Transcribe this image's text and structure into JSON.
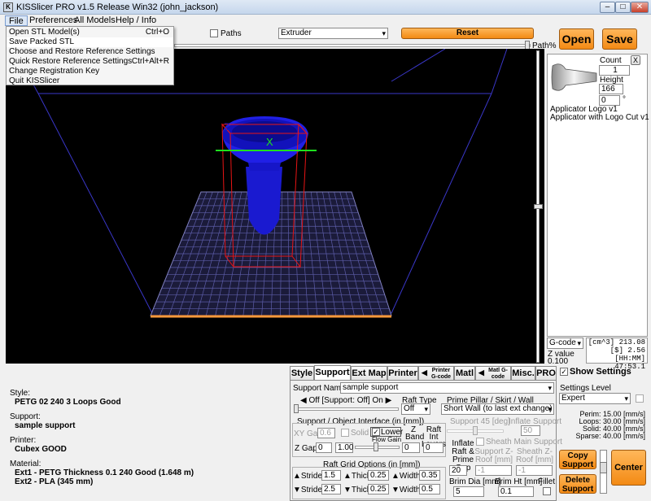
{
  "window": {
    "title": "KISSlicer PRO v1.5 Release Win32 (john_jackson)",
    "min": "–",
    "max": "□",
    "close": "✕"
  },
  "menu": [
    "File",
    "Preferences",
    "All Models",
    "Help / Info"
  ],
  "file_menu": [
    {
      "label": "Open STL Model(s)",
      "shortcut": "Ctrl+O"
    },
    {
      "label": "Save Packed STL",
      "shortcut": ""
    },
    {
      "label": "Choose and Restore Reference Settings",
      "shortcut": ""
    },
    {
      "label": "Quick Restore Reference Settings",
      "shortcut": "Ctrl+Alt+R"
    },
    {
      "label": "Change Registration Key",
      "shortcut": ""
    },
    {
      "label": "Quit KISSlicer",
      "shortcut": ""
    }
  ],
  "toolbar": {
    "paths_label": "Paths",
    "extruder_value": "Extruder",
    "reset_label": "Reset",
    "open_label": "Open",
    "save_label": "Save",
    "path_pct_label": "Path%"
  },
  "viewport": {
    "axis_x": "X",
    "axis_z": "Z"
  },
  "models": {
    "count_label": "Count",
    "count_value": "1",
    "height_label": "Height",
    "height_value": "166",
    "rot_value": "0",
    "rot_unit": "°",
    "close": "X",
    "items": [
      "Applicator Logo v1",
      "Applicator with Logo Cut v1"
    ]
  },
  "stats": {
    "mode": "G-code",
    "lines": [
      "[cm^3] 213.08",
      "[$] 2.56",
      "[HH:MM] 47:53.1"
    ],
    "z_label": "Z value",
    "z_value": "0.100"
  },
  "info": {
    "style_label": "Style:",
    "style_value": "PETG 02 240 3 Loops Good",
    "support_label": "Support:",
    "support_value": "sample support",
    "printer_label": "Printer:",
    "printer_value": "Cubex GOOD",
    "material_label": "Material:",
    "ext1": "Ext1 - PETG Thickness 0.1 240 Good (1.648 m)",
    "ext2": "Ext2 - PLA (345 mm)"
  },
  "tabs": [
    "Style",
    "Support",
    "Ext Map",
    "Printer",
    "Printer G-code",
    "Matl",
    "Matl G-code",
    "Misc.",
    "PRO"
  ],
  "support": {
    "name_label": "Support Name",
    "name_value": "sample support",
    "off_label": "Off [Support: Off] On",
    "raft_type_label": "Raft Type",
    "raft_type_value": "Off",
    "prime_label": "Prime Pillar / Skirt / Wall",
    "prime_value": "Short Wall (to last ext change)",
    "angle_label": "Support 45 [deg]",
    "inflate_support_label": "Inflate Support",
    "inflate_support_value": "50",
    "iface_label": "Support / Object Interface (in [mm])",
    "xy_gap_label": "XY Gap",
    "xy_gap_value": "0.6",
    "solid_label": "Solid",
    "lower_label": "Lower",
    "z_band_label": "Z Band",
    "z_band_value": "0",
    "raft_int_label": "Raft Int Layers",
    "raft_int_value": "0",
    "flow_gain_label": "Flow Gain",
    "z_gap_label": "Z Gap",
    "z_gap_value": "0",
    "flow_value": "1.00",
    "inflate_raft_label": "Inflate Raft & Prime Gap",
    "inflate_raft_value": "20",
    "sheath_label": "Sheath Main Support",
    "zroof_support_label": "Support Z-Roof [mm]",
    "zroof_support_value": "-1",
    "zroof_sheath_label": "Sheath Z-Roof [mm]",
    "zroof_sheath_value": "-1",
    "raft_grid_label": "Raft Grid Options (in [mm])",
    "stride_label": "Stride",
    "thick_label": "Thick",
    "width_label": "Width",
    "row1": {
      "stride": "1.5",
      "thick": "0.25",
      "width": "0.35"
    },
    "row2": {
      "stride": "2.5",
      "thick": "0.25",
      "width": "0.5"
    },
    "brim_dia_label": "Brim Dia [mm]",
    "brim_dia_value": "5",
    "brim_ht_label": "Brim Ht [mm]",
    "brim_ht_value": "0.1",
    "fillet_label": "Fillet"
  },
  "settings": {
    "show_label": "Show Settings",
    "level_label": "Settings Level",
    "level_value": "Expert",
    "speeds": [
      "Perim: 15.00 [mm/s]",
      "Loops: 30.00 [mm/s]",
      "Solid: 40.00 [mm/s]",
      "Sparse: 40.00 [mm/s]"
    ],
    "copy_label": "Copy Support",
    "delete_label": "Delete Support",
    "center_label": "Center"
  }
}
